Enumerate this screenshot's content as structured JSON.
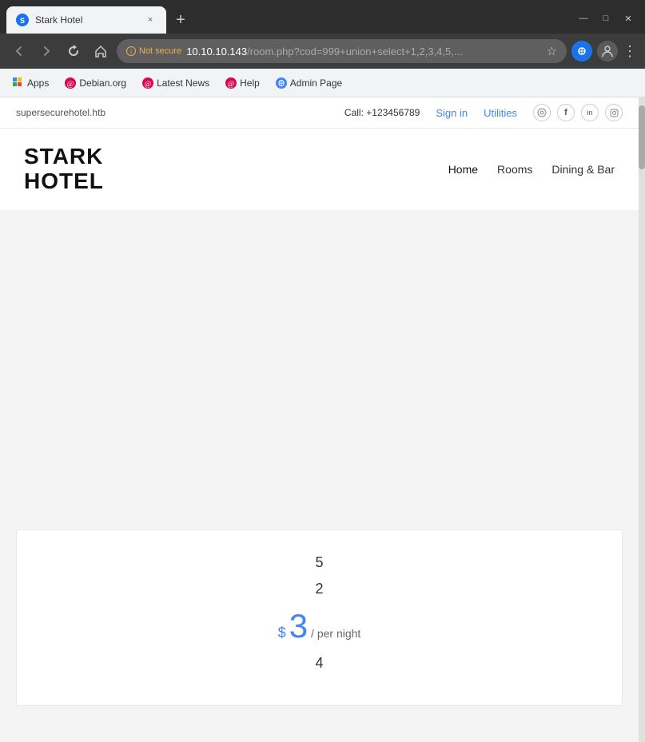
{
  "browser": {
    "tab": {
      "favicon_text": "S",
      "title": "Stark Hotel",
      "close_icon": "×"
    },
    "new_tab_icon": "+",
    "window_controls": {
      "minimize": "—",
      "maximize": "□",
      "close": "✕"
    },
    "nav": {
      "back_icon": "←",
      "forward_icon": "→",
      "reload_icon": "↻",
      "home_icon": "⌂"
    },
    "address": {
      "security_label": "Not secure",
      "url_domain": "10.10.10.143",
      "url_path": "/room.php?cod=999+union+select+1,2,3,4,5,..."
    },
    "star_icon": "☆",
    "chrome_status": "●",
    "profile_icon": "👤",
    "menu_icon": "⋮"
  },
  "bookmarks": [
    {
      "id": "apps",
      "icon_type": "grid",
      "label": "Apps"
    },
    {
      "id": "debian",
      "icon_type": "red-circle",
      "label": "Debian.org"
    },
    {
      "id": "latestnews",
      "icon_type": "red-circle",
      "label": "Latest News"
    },
    {
      "id": "help",
      "icon_type": "red-circle",
      "label": "Help"
    },
    {
      "id": "adminpage",
      "icon_type": "globe",
      "label": "Admin Page"
    }
  ],
  "topbar": {
    "domain": "supersecurehotel.htb",
    "call": "Call: +123456789",
    "signin": "Sign in",
    "utilities": "Utilities",
    "social_icons": [
      "○",
      "f",
      "in",
      "◎"
    ]
  },
  "hotel": {
    "name_line1": "STARK",
    "name_line2": "HOTEL",
    "nav_items": [
      "Home",
      "Rooms",
      "Dining & Bar"
    ]
  },
  "room_card": {
    "number1": "5",
    "number2": "2",
    "price_dollar": "$",
    "price_amount": "3",
    "price_per": "/ per night",
    "number3": "4"
  }
}
